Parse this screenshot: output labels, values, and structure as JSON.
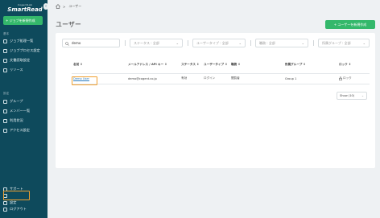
{
  "sidebar": {
    "logo_sub": "CogentLab",
    "logo_main": "SmartRead",
    "new_job_label": "+ ジョブを新規作成",
    "section_basic": "基本",
    "section_settings": "設定",
    "items_basic": [
      {
        "label": "ジョブ処理一覧",
        "icon": "list-icon"
      },
      {
        "label": "ジョブプロセス設定",
        "icon": "process-icon"
      },
      {
        "label": "文書読取設定",
        "icon": "document-icon"
      },
      {
        "label": "リソース",
        "icon": "resource-icon"
      }
    ],
    "items_settings": [
      {
        "label": "グループ",
        "icon": "group-icon"
      },
      {
        "label": "メンバー一覧",
        "icon": "members-icon"
      },
      {
        "label": "利用状況",
        "icon": "usage-icon"
      },
      {
        "label": "アクセス設定",
        "icon": "access-icon"
      }
    ],
    "items_bottom": [
      {
        "label": "サポート",
        "icon": "help-icon"
      },
      {
        "label": "",
        "icon": "settings-icon"
      },
      {
        "label": "設定",
        "icon": "gear-icon"
      },
      {
        "label": "ログアウト",
        "icon": "logout-icon"
      }
    ]
  },
  "breadcrumb": {
    "separator": ">",
    "current": "ユーザー"
  },
  "page": {
    "title": "ユーザー",
    "new_user_label": "+ ユーザーを新規作成"
  },
  "filters": {
    "search_value": "demo",
    "status_placeholder": "ステータス : 全部",
    "user_type_placeholder": "ユーザータイプ : 全部",
    "position_placeholder": "職務 : 全部",
    "group_placeholder": "所属グループ : 全部"
  },
  "table": {
    "headers": [
      "名前 ⇕",
      "メールアドレス / API キー ⇕",
      "ステータス ⇕",
      "ユーザータイプ ⇕",
      "職務 ⇕",
      "所属グループ ⇕",
      "ロック ⇕"
    ],
    "rows": [
      {
        "name": "Demo User",
        "email": "demo@cogent.co.jp",
        "status": "有効",
        "user_type": "ログイン",
        "role": "閲覧者",
        "group": "Group 1",
        "lock": "ロック"
      }
    ]
  },
  "pager": {
    "label": "Show (10)"
  },
  "colors": {
    "sidebar": "#0e4a5c",
    "accent_green": "#34b86b",
    "highlight": "#f0a030",
    "link": "#2a7cc0"
  }
}
